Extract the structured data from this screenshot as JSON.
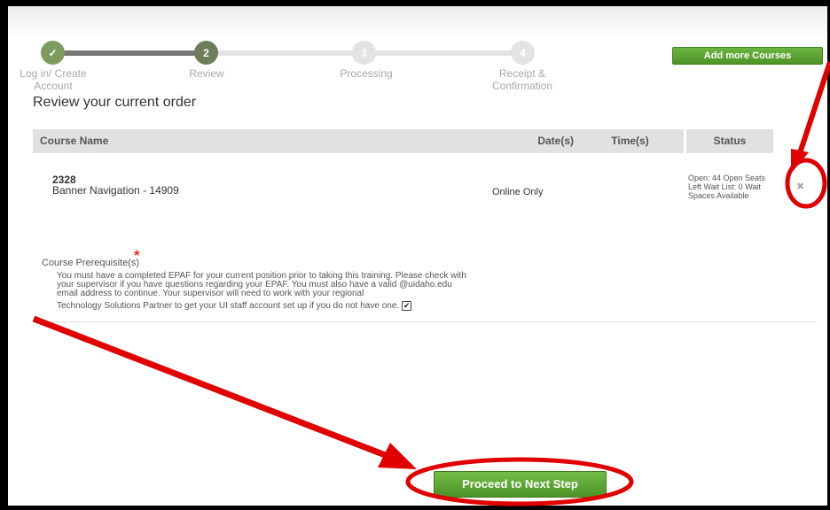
{
  "steps": [
    {
      "label": "Log in/ Create Account",
      "number": "✓",
      "state": "done"
    },
    {
      "label": "Review",
      "number": "2",
      "state": "current"
    },
    {
      "label": "Processing",
      "number": "3",
      "state": "pending"
    },
    {
      "label": "Receipt & Confirmation",
      "number": "4",
      "state": "pending"
    }
  ],
  "add_courses_label": "Add more Courses",
  "page_title": "Review your current order",
  "table": {
    "headers": {
      "name": "Course Name",
      "dates": "Date(s)",
      "times": "Time(s)",
      "status": "Status"
    },
    "row": {
      "id": "2328",
      "name": "Banner Navigation - 14909",
      "dates": "Online Only",
      "time": "",
      "status": "Open: 44 Open Seats Left Wait List: 0 Wait Spaces Available"
    }
  },
  "prereq": {
    "label": "Course Prerequisite(s)",
    "required_marker": "*",
    "text": "You must have a completed EPAF for your current position prior to taking this training. Please check with your supervisor if you have questions regarding your EPAF. You must also have a valid @uidaho.edu email address to continue. Your supervisor will need to work with your regional",
    "text_last": "Technology Solutions Partner to get your UI staff account set up if you do not have one.",
    "checked": true
  },
  "proceed_label": "Proceed to Next Step",
  "colors": {
    "accent_green": "#4e9426",
    "annotation_red": "#e00000"
  },
  "icons": {
    "remove": "close-icon",
    "check": "checkmark-icon"
  }
}
